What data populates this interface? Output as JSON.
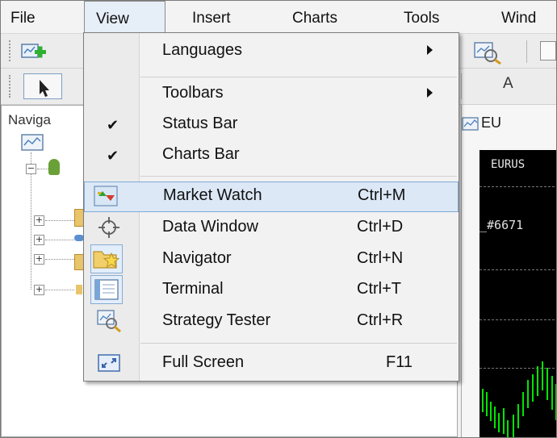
{
  "menubar": {
    "items": [
      "File",
      "View",
      "Insert",
      "Charts",
      "Tools",
      "Wind"
    ]
  },
  "toolbar2": {
    "text_label": "A"
  },
  "navigator": {
    "title": "Naviga"
  },
  "chart": {
    "tab_label": "EU",
    "symbol": "EURUS",
    "price_label": "_#6671"
  },
  "view_menu": {
    "items": [
      {
        "label": "Languages",
        "shortcut": "",
        "submenu": true
      },
      {
        "label": "Toolbars",
        "shortcut": "",
        "submenu": true
      },
      {
        "label": "Status Bar",
        "shortcut": "",
        "checked": true
      },
      {
        "label": "Charts Bar",
        "shortcut": "",
        "checked": true
      },
      {
        "label": "Market Watch",
        "shortcut": "Ctrl+M",
        "icon": "market-watch-icon"
      },
      {
        "label": "Data Window",
        "shortcut": "Ctrl+D",
        "icon": "crosshair-icon"
      },
      {
        "label": "Navigator",
        "shortcut": "Ctrl+N",
        "icon": "navigator-folder-star-icon"
      },
      {
        "label": "Terminal",
        "shortcut": "Ctrl+T",
        "icon": "terminal-icon"
      },
      {
        "label": "Strategy Tester",
        "shortcut": "Ctrl+R",
        "icon": "strategy-tester-icon"
      },
      {
        "label": "Full Screen",
        "shortcut": "F11",
        "icon": "full-screen-icon"
      }
    ],
    "highlighted": "Market Watch"
  },
  "colors": {
    "highlight_bg": "#dce8f6",
    "highlight_border": "#7fa9d6",
    "chart_bg": "#000000",
    "candle_green": "#00ff00"
  }
}
